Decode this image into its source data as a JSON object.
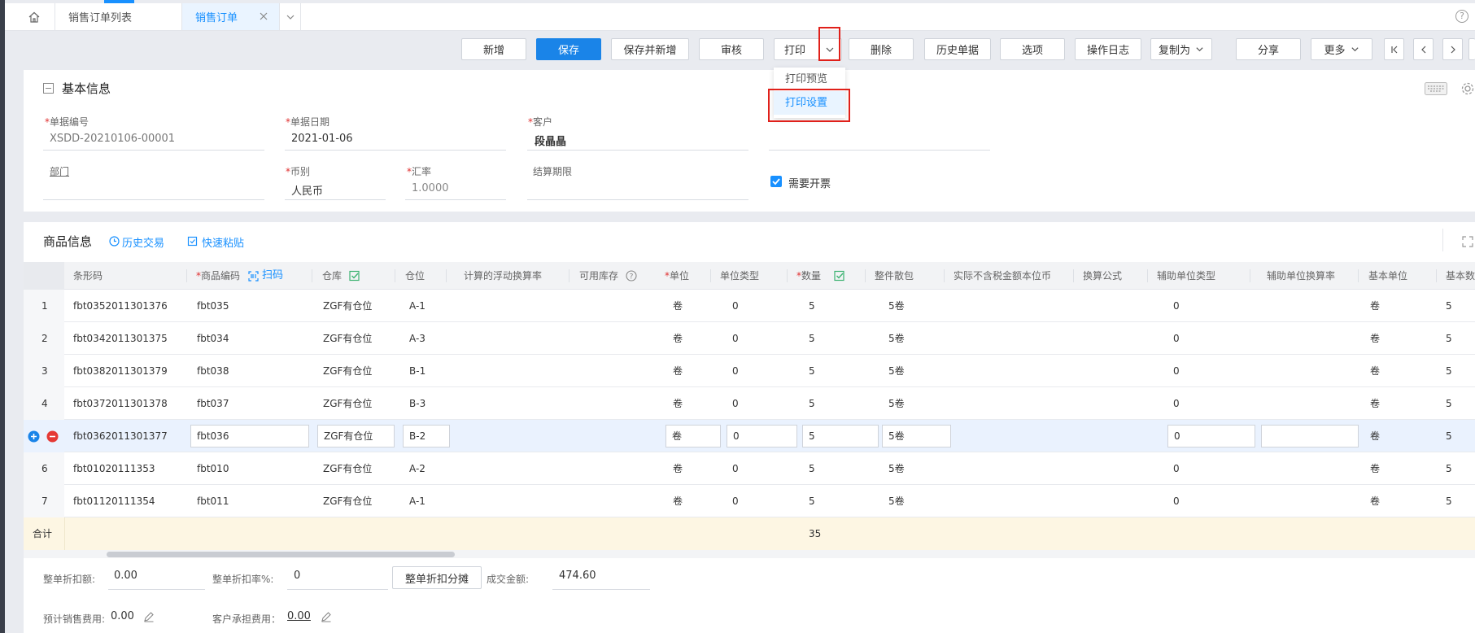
{
  "tabs": {
    "items": [
      {
        "label": "销售订单列表"
      },
      {
        "label": "销售订单"
      }
    ],
    "help": "?"
  },
  "toolbar": {
    "add": "新增",
    "save": "保存",
    "save_new": "保存并新增",
    "audit": "审核",
    "print": "打印",
    "delete": "删除",
    "history": "历史单据",
    "options": "选项",
    "log": "操作日志",
    "copy_as": "复制为",
    "share": "分享",
    "more": "更多"
  },
  "print_menu": {
    "preview": "打印预览",
    "settings": "打印设置"
  },
  "basic": {
    "title": "基本信息",
    "doc_no_label": "单据编号",
    "doc_no": "XSDD-20210106-00001",
    "doc_date_label": "单据日期",
    "doc_date": "2021-01-06",
    "customer_label": "客户",
    "customer": "段晶晶",
    "dept_label": "部门",
    "currency_label": "币别",
    "currency": "人民币",
    "rate_label": "汇率",
    "rate": "1.0000",
    "settle_label": "结算期限",
    "invoice_label": "需要开票",
    "invoice_checked": true
  },
  "goods": {
    "title": "商品信息",
    "history_link": "历史交易",
    "paste_link": "快速粘贴",
    "scan_link": "扫码",
    "columns": {
      "barcode": "条形码",
      "code": "商品编码",
      "warehouse": "仓库",
      "location": "仓位",
      "float_rate": "计算的浮动换算率",
      "stock": "可用库存",
      "unit": "单位",
      "unit_type": "单位类型",
      "qty": "数量",
      "pack": "整件散包",
      "amount": "实际不含税金额本位币",
      "formula": "换算公式",
      "aux_type": "辅助单位类型",
      "aux_rate": "辅助单位换算率",
      "base_unit": "基本单位",
      "base_qty": "基本数"
    },
    "rows": [
      {
        "no": "1",
        "barcode": "fbt0352011301376",
        "code": "fbt035",
        "warehouse": "ZGF有仓位",
        "location": "A-1",
        "unit": "卷",
        "unit_type": "0",
        "qty": "5",
        "pack": "5卷",
        "aux_type": "0",
        "base_unit": "卷",
        "base_qty": "5"
      },
      {
        "no": "2",
        "barcode": "fbt0342011301375",
        "code": "fbt034",
        "warehouse": "ZGF有仓位",
        "location": "A-3",
        "unit": "卷",
        "unit_type": "0",
        "qty": "5",
        "pack": "5卷",
        "aux_type": "0",
        "base_unit": "卷",
        "base_qty": "5"
      },
      {
        "no": "3",
        "barcode": "fbt0382011301379",
        "code": "fbt038",
        "warehouse": "ZGF有仓位",
        "location": "B-1",
        "unit": "卷",
        "unit_type": "0",
        "qty": "5",
        "pack": "5卷",
        "aux_type": "0",
        "base_unit": "卷",
        "base_qty": "5"
      },
      {
        "no": "4",
        "barcode": "fbt0372011301378",
        "code": "fbt037",
        "warehouse": "ZGF有仓位",
        "location": "B-3",
        "unit": "卷",
        "unit_type": "0",
        "qty": "5",
        "pack": "5卷",
        "aux_type": "0",
        "base_unit": "卷",
        "base_qty": "5"
      },
      {
        "no": "",
        "barcode": "fbt0362011301377",
        "code": "fbt036",
        "warehouse": "ZGF有仓位",
        "location": "B-2",
        "unit": "卷",
        "unit_type": "0",
        "qty": "5",
        "pack": "5卷",
        "aux_type": "0",
        "base_unit": "卷",
        "base_qty": "5"
      },
      {
        "no": "6",
        "barcode": "fbt01020111353",
        "code": "fbt010",
        "warehouse": "ZGF有仓位",
        "location": "A-2",
        "unit": "卷",
        "unit_type": "0",
        "qty": "5",
        "pack": "5卷",
        "aux_type": "0",
        "base_unit": "卷",
        "base_qty": "5"
      },
      {
        "no": "7",
        "barcode": "fbt01120111354",
        "code": "fbt011",
        "warehouse": "ZGF有仓位",
        "location": "A-1",
        "unit": "卷",
        "unit_type": "0",
        "qty": "5",
        "pack": "5卷",
        "aux_type": "0",
        "base_unit": "卷",
        "base_qty": "5"
      }
    ],
    "total_label": "合计",
    "total_qty": "35"
  },
  "bottom": {
    "discount_amount_label": "整单折扣额:",
    "discount_amount": "0.00",
    "discount_rate_label": "整单折扣率%:",
    "discount_rate": "0",
    "spread_button": "整单折扣分摊",
    "deal_amount_label": "成交金额:",
    "deal_amount": "474.60",
    "sales_cost_label": "预计销售费用:",
    "sales_cost": "0.00",
    "customer_cost_label": "客户承担费用：",
    "customer_cost": "0.00"
  },
  "colors": {
    "accent": "#1890ff",
    "primary_button": "#1a84e8",
    "highlight_box": "#e0201a",
    "total_row": "#fdf6e3",
    "selected_row": "#eaf2fe"
  }
}
